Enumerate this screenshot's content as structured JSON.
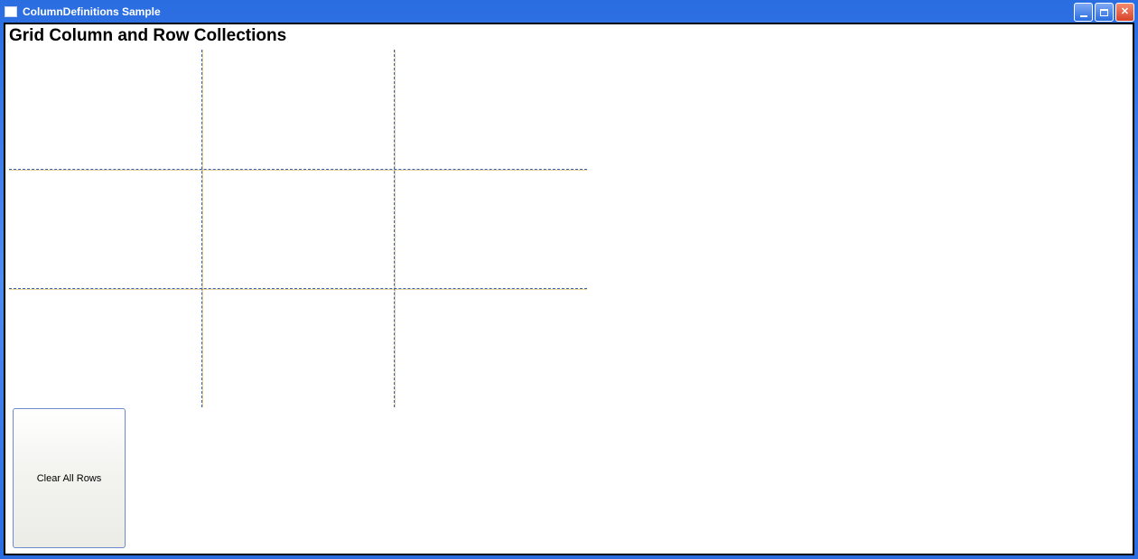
{
  "titlebar": {
    "title": "ColumnDefinitions Sample"
  },
  "header": {
    "heading": "Grid Column and Row Collections"
  },
  "grid": {
    "columns": 3,
    "rows": 3
  },
  "controls": {
    "clear_rows_label": "Clear All Rows"
  },
  "window_buttons": {
    "minimize": "Minimize",
    "maximize": "Maximize",
    "close": "Close"
  }
}
